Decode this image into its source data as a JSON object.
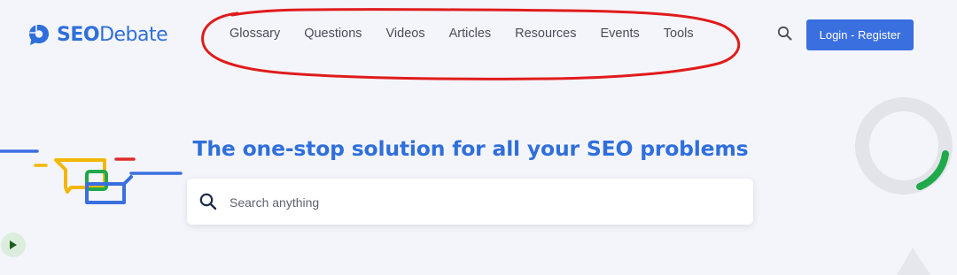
{
  "header": {
    "logo": {
      "bold": "SEO",
      "regular": "Debate"
    },
    "nav": [
      {
        "label": "Glossary"
      },
      {
        "label": "Questions"
      },
      {
        "label": "Videos"
      },
      {
        "label": "Articles"
      },
      {
        "label": "Resources"
      },
      {
        "label": "Events"
      },
      {
        "label": "Tools"
      }
    ],
    "login_label": "Login - Register"
  },
  "hero": {
    "title": "The one-stop solution for all your SEO problems",
    "search": {
      "placeholder": "Search anything",
      "value": ""
    }
  },
  "icons": {
    "search": "search-icon",
    "play": "play-icon",
    "logo": "logo-speech-bubble-icon"
  },
  "colors": {
    "brand_blue": "#2f6fdc",
    "button_blue": "#3a6fe0",
    "background": "#f4f5fa",
    "annotation_red": "#e01b1b",
    "accent_green": "#1fa94a",
    "accent_yellow": "#f2b705",
    "accent_red": "#e02b2b"
  }
}
